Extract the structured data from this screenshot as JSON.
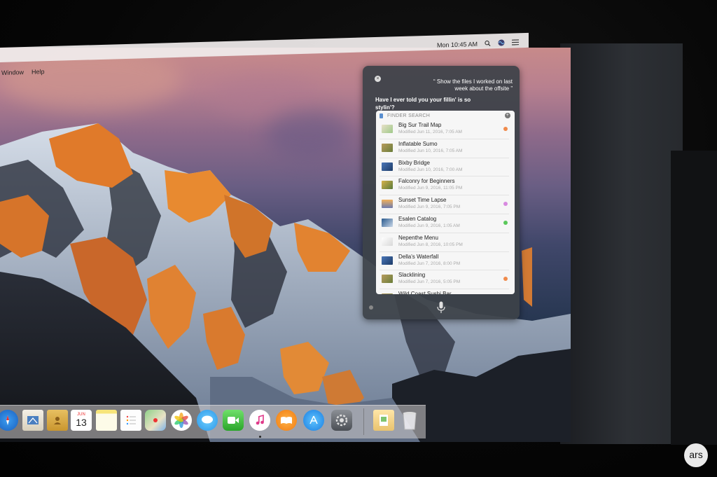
{
  "menubar": {
    "items": [
      "Window",
      "Help"
    ],
    "clock": "Mon 10:45 AM",
    "icons": [
      "search-icon",
      "siri-icon",
      "notification-center-icon"
    ]
  },
  "siri": {
    "query": "“ Show the files I worked on last week about the offsite ”",
    "answer": "Have I ever told you your fillin' is so stylin'?",
    "finder_header": "FINDER SEARCH",
    "files": [
      {
        "name": "Big Sur Trail Map",
        "modified": "Modified Jun 11, 2016, 7:05 AM",
        "tag_color": "#f08a4b",
        "thumb": "map"
      },
      {
        "name": "Inflatable Sumo",
        "modified": "Modified Jun 10, 2016, 7:05 AM",
        "tag_color": "",
        "thumb": "photo"
      },
      {
        "name": "Bixby Bridge",
        "modified": "Modified Jun 10, 2016, 7:00 AM",
        "tag_color": "",
        "thumb": "photo-blue"
      },
      {
        "name": "Falconry for Beginners",
        "modified": "Modified Jun 9, 2016, 11:05 PM",
        "tag_color": "",
        "thumb": "book"
      },
      {
        "name": "Sunset Time Lapse",
        "modified": "Modified Jun 9, 2016, 7:05 PM",
        "tag_color": "#d88ae0",
        "thumb": "video"
      },
      {
        "name": "Esalen Catalog",
        "modified": "Modified Jun 9, 2016, 1:05 AM",
        "tag_color": "#5ac85a",
        "thumb": "doc-blue"
      },
      {
        "name": "Nepenthe Menu",
        "modified": "Modified Jun 8, 2016, 10:05 PM",
        "tag_color": "",
        "thumb": "doc-white"
      },
      {
        "name": "Della's Waterfall",
        "modified": "Modified Jun 7, 2016, 8:00 PM",
        "tag_color": "",
        "thumb": "photo-blue"
      },
      {
        "name": "Slacklining",
        "modified": "Modified Jun 7, 2016, 5:05 PM",
        "tag_color": "#f08a4b",
        "thumb": "photo"
      },
      {
        "name": "Wild Coast Sushi Bar",
        "modified": "",
        "tag_color": "",
        "thumb": "photo"
      }
    ]
  },
  "dock": {
    "calendar_month": "JUN",
    "calendar_day": "13",
    "apps": [
      "safari-icon",
      "mail-icon",
      "contacts-icon",
      "calendar-icon",
      "notes-icon",
      "reminders-icon",
      "maps-icon",
      "photos-icon",
      "messages-icon",
      "facetime-icon",
      "itunes-icon",
      "ibooks-icon",
      "app-store-icon",
      "system-preferences-icon",
      "preview-icon",
      "trash-icon"
    ]
  },
  "watermark": "ars",
  "colors": {
    "siri_panel": "#3c4248",
    "menubar": "#f0ecec",
    "accent_orange": "#f08a4b"
  }
}
